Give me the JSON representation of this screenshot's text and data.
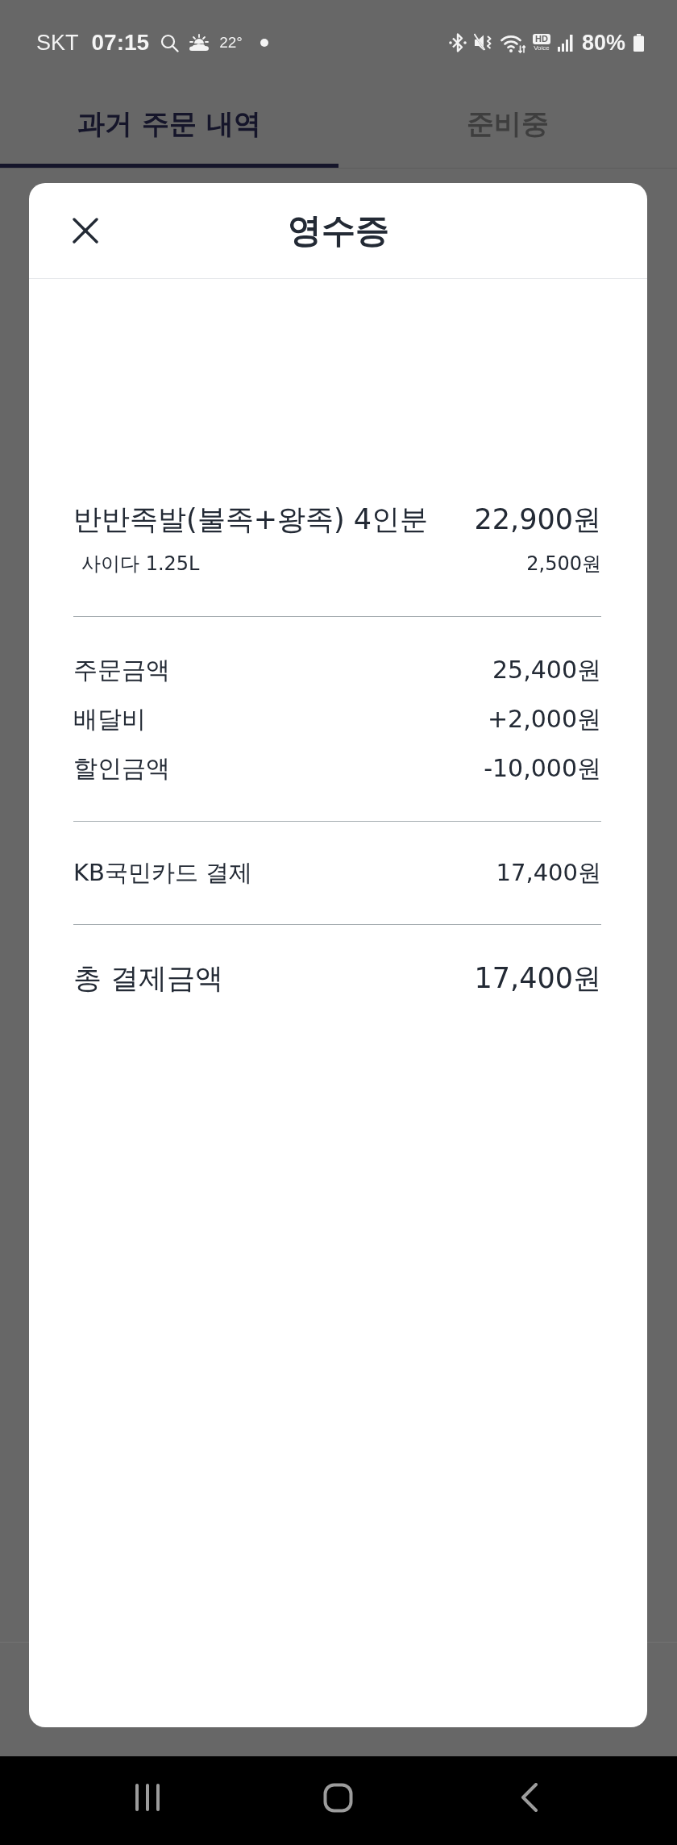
{
  "status_bar": {
    "carrier": "SKT",
    "time": "07:15",
    "temperature": "22°",
    "hd_badge": "HD",
    "voice_label": "Voice",
    "battery": "80%"
  },
  "tabs": [
    {
      "label": "과거 주문 내역",
      "selected": true
    },
    {
      "label": "준비중",
      "selected": false
    }
  ],
  "receipt": {
    "title": "영수증",
    "items": [
      {
        "kind": "main",
        "name": "반반족발(불족+왕족) 4인분",
        "price": "22,900원"
      },
      {
        "kind": "option",
        "name": "사이다 1.25L",
        "price": "2,500원"
      }
    ],
    "summary": [
      {
        "label": "주문금액",
        "amount": "25,400원"
      },
      {
        "label": "배달비",
        "amount": "+2,000원"
      },
      {
        "label": "할인금액",
        "amount": "-10,000원"
      }
    ],
    "payments": [
      {
        "label": "KB국민카드 결제",
        "amount": "17,400원"
      }
    ],
    "total": {
      "label": "총 결제금액",
      "amount": "17,400원"
    }
  }
}
